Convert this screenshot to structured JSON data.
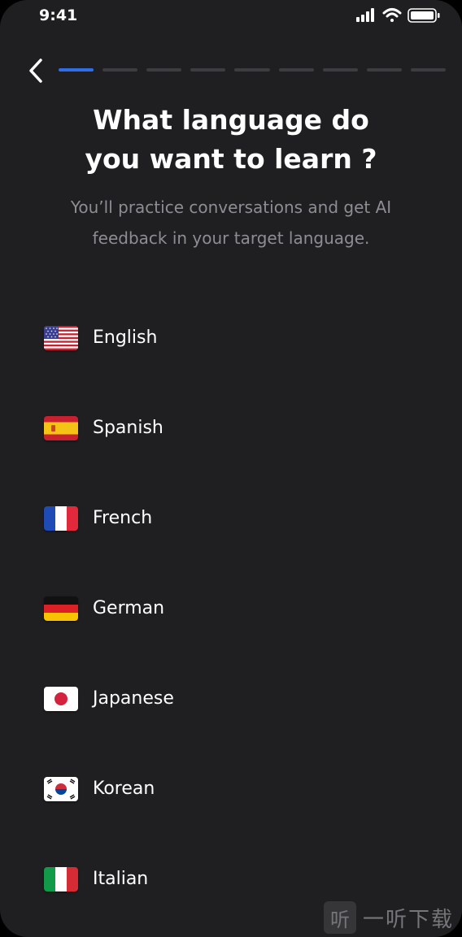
{
  "status_bar": {
    "time": "9:41"
  },
  "progress": {
    "total_steps": 9,
    "current_step": 1
  },
  "header": {
    "title_line1": "What language do",
    "title_line2": "you want to learn ?",
    "subtitle_line1": "You’ll practice conversations and get AI",
    "subtitle_line2": "feedback in your target language."
  },
  "languages": [
    {
      "label": "English",
      "flag": "us-flag-icon"
    },
    {
      "label": "Spanish",
      "flag": "spain-flag-icon"
    },
    {
      "label": "French",
      "flag": "france-flag-icon"
    },
    {
      "label": "German",
      "flag": "germany-flag-icon"
    },
    {
      "label": "Japanese",
      "flag": "japan-flag-icon"
    },
    {
      "label": "Korean",
      "flag": "korea-flag-icon"
    },
    {
      "label": "Italian",
      "flag": "italy-flag-icon"
    }
  ],
  "watermark": {
    "glyph": "听",
    "text": "一听下载"
  },
  "colors": {
    "background": "#1f1e21",
    "accent": "#2f6ee8",
    "muted_text": "#8e8d93"
  }
}
